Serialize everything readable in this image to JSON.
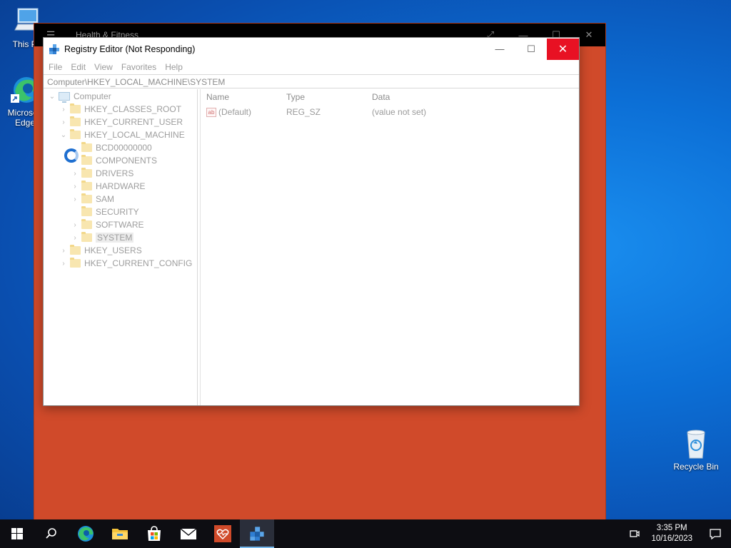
{
  "desktop": {
    "icons": [
      {
        "label": "This PC",
        "icon": "this-pc-icon"
      },
      {
        "label": "Microsoft Edge",
        "icon": "edge-icon"
      },
      {
        "label": "Recycle Bin",
        "icon": "recycle-bin-icon"
      }
    ]
  },
  "background_window": {
    "title": "Health & Fitness",
    "color": "#d04a2a"
  },
  "regedit": {
    "title": "Registry Editor (Not Responding)",
    "controls": {
      "minimize": "—",
      "maximize": "☐",
      "close": "✕"
    },
    "menu": [
      "File",
      "Edit",
      "View",
      "Favorites",
      "Help"
    ],
    "address": "Computer\\HKEY_LOCAL_MACHINE\\SYSTEM",
    "tree": [
      {
        "label": "Computer",
        "chevron": "⌄",
        "level": 0,
        "icon": "computer-icon"
      },
      {
        "label": "HKEY_CLASSES_ROOT",
        "chevron": "›",
        "level": 1
      },
      {
        "label": "HKEY_CURRENT_USER",
        "chevron": "›",
        "level": 1
      },
      {
        "label": "HKEY_LOCAL_MACHINE",
        "chevron": "⌄",
        "level": 1
      },
      {
        "label": "BCD00000000",
        "chevron": "",
        "level": 2
      },
      {
        "label": "COMPONENTS",
        "chevron": "",
        "level": 2
      },
      {
        "label": "DRIVERS",
        "chevron": "›",
        "level": 2
      },
      {
        "label": "HARDWARE",
        "chevron": "›",
        "level": 2
      },
      {
        "label": "SAM",
        "chevron": "›",
        "level": 2
      },
      {
        "label": "SECURITY",
        "chevron": "",
        "level": 2
      },
      {
        "label": "SOFTWARE",
        "chevron": "›",
        "level": 2
      },
      {
        "label": "SYSTEM",
        "chevron": "›",
        "level": 2,
        "selected": true
      },
      {
        "label": "HKEY_USERS",
        "chevron": "›",
        "level": 1
      },
      {
        "label": "HKEY_CURRENT_CONFIG",
        "chevron": "›",
        "level": 1
      }
    ],
    "columns": {
      "name": "Name",
      "type": "Type",
      "data": "Data"
    },
    "values": [
      {
        "name": "(Default)",
        "type": "REG_SZ",
        "data": "(value not set)",
        "icon_text": "ab"
      }
    ]
  },
  "taskbar": {
    "buttons": [
      {
        "name": "start-button",
        "icon": "windows-logo-icon"
      },
      {
        "name": "search-button",
        "icon": "search-icon"
      },
      {
        "name": "taskbar-edge",
        "icon": "edge-icon"
      },
      {
        "name": "taskbar-file-explorer",
        "icon": "folder-icon"
      },
      {
        "name": "taskbar-store",
        "icon": "store-icon"
      },
      {
        "name": "taskbar-mail",
        "icon": "mail-icon"
      },
      {
        "name": "taskbar-health-fitness",
        "icon": "heart-icon"
      },
      {
        "name": "taskbar-regedit",
        "icon": "regedit-icon",
        "active": true
      }
    ],
    "clock": {
      "time": "3:35 PM",
      "date": "10/16/2023"
    }
  }
}
